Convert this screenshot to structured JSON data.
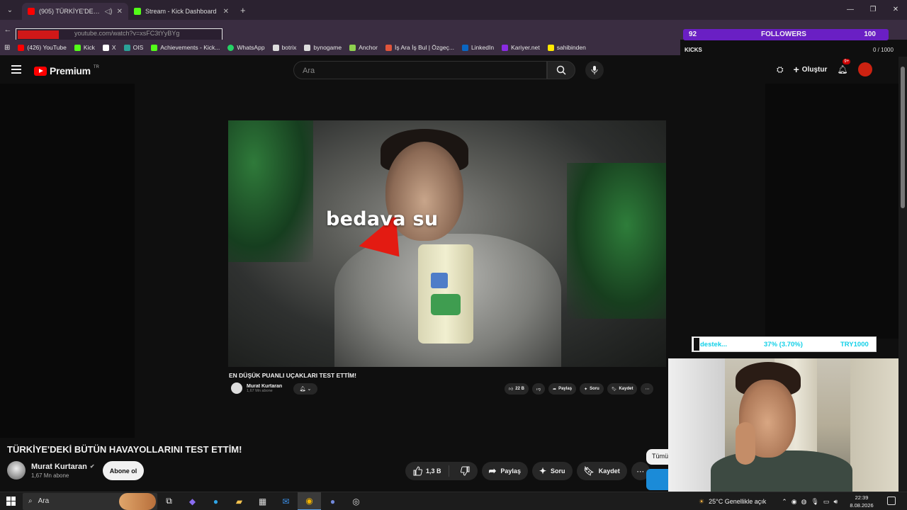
{
  "browser": {
    "tabs": [
      {
        "label": "(905) TÜRKİYE'DEKİ BÜTÜN",
        "active": true,
        "favicon_color": "#ff0000"
      },
      {
        "label": "Stream - Kick Dashboard",
        "active": false,
        "favicon_color": "#53fc18"
      }
    ],
    "url": "youtube.com/watch?v=xsFC3tYyBYg",
    "bookmarks": [
      {
        "label": "(426) YouTube",
        "color": "#ff0000"
      },
      {
        "label": "Kick",
        "color": "#53fc18"
      },
      {
        "label": "X",
        "color": "#ffffff"
      },
      {
        "label": "OIS",
        "color": "#2aa198"
      },
      {
        "label": "Achievements - Kick...",
        "color": "#53fc18"
      },
      {
        "label": "WhatsApp",
        "color": "#25d366"
      },
      {
        "label": "botrix",
        "color": "#dddddd"
      },
      {
        "label": "bynogame",
        "color": "#dddddd"
      },
      {
        "label": "Anchor",
        "color": "#8fd14f"
      },
      {
        "label": "İş Ara İş Bul | Özgeç...",
        "color": "#e0553b"
      },
      {
        "label": "LinkedIn",
        "color": "#0a66c2"
      },
      {
        "label": "Kariyer.net",
        "color": "#8a2be2"
      },
      {
        "label": "sahibinden",
        "color": "#ffe800"
      }
    ]
  },
  "overlay": {
    "followers_current": "92",
    "followers_label": "FOLLOWERS",
    "followers_goal": "100",
    "kicks_label": "KICKS",
    "kicks_progress": "0 / 1000",
    "donation_name": "destek...",
    "donation_percent": "37% (3.70%)",
    "donation_goal": "TRY1000"
  },
  "youtube": {
    "logo_text": "Premium",
    "logo_region": "TR",
    "search_placeholder": "Ara",
    "create_label": "Oluştur",
    "notif_badge": "9+",
    "video_caption": "bedava su",
    "small_title": "EN DÜŞÜK PUANLI UÇAKLARI TEST ETTİM!",
    "small_channel": "Murat Kurtaran",
    "small_subs": "1,67 Mn abone",
    "small_actions": [
      "22 B",
      "Paylaş",
      "Soru",
      "Kaydet"
    ],
    "title": "TÜRKİYE'DEKİ BÜTÜN HAVAYOLLARINI TEST ETTİM!",
    "channel": "Murat Kurtaran",
    "subscribers": "1,67 Mn abone",
    "subscribe_label": "Abone ol",
    "likes": "1,3 B",
    "share_label": "Paylaş",
    "ask_label": "Soru",
    "save_label": "Kaydet",
    "chip_all": "Tümü"
  },
  "taskbar": {
    "search_placeholder": "Ara",
    "weather": "25°C  Genellikle açık",
    "time": "22:39",
    "date": "8.08.2026"
  }
}
